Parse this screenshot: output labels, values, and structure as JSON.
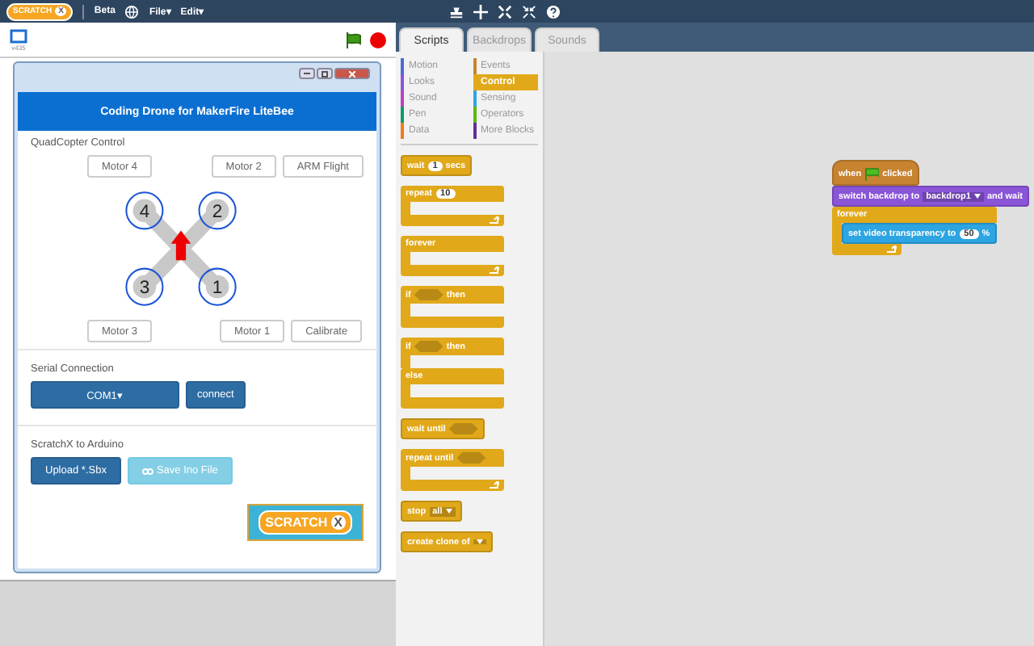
{
  "menu_bar": {
    "logo": {
      "text": "SCRATCH",
      "badge": "X"
    },
    "items": [
      {
        "kind": "label",
        "text": "Beta"
      },
      {
        "kind": "globe"
      },
      {
        "kind": "menu",
        "text": "File▾"
      },
      {
        "kind": "menu",
        "text": "Edit▾"
      }
    ]
  },
  "stage": {
    "version": "v435"
  },
  "dialog": {
    "title": "Coding Drone for MakerFire LiteBee",
    "quadcopter": {
      "heading": "QuadCopter Control",
      "top_buttons": [
        "Motor 4",
        "Motor 2",
        "ARM Flight"
      ],
      "bottom_buttons": [
        "Motor 3",
        "Motor 1",
        "Calibrate"
      ],
      "motors": [
        "4",
        "2",
        "3",
        "1"
      ]
    },
    "serial": {
      "heading": "Serial Connection",
      "port": "COM1▾",
      "button": "connect"
    },
    "arduino": {
      "heading": "ScratchX to Arduino",
      "buttons": [
        {
          "text": "Upload *.Sbx",
          "disabled": false,
          "link_icon": false
        },
        {
          "text": "Save Ino File",
          "disabled": true,
          "link_icon": true
        }
      ]
    },
    "logo": {
      "text": "SCRATCH",
      "badge": "X"
    }
  },
  "tabs": [
    {
      "label": "Scripts",
      "selected": true
    },
    {
      "label": "Backdrops",
      "selected": false
    },
    {
      "label": "Sounds",
      "selected": false
    }
  ],
  "categories": [
    {
      "label": "Motion",
      "color": "#4a6cd4",
      "selected": false
    },
    {
      "label": "Events",
      "color": "#c88330",
      "selected": false
    },
    {
      "label": "Looks",
      "color": "#8a55d7",
      "selected": false
    },
    {
      "label": "Control",
      "color": "#e1a91a",
      "selected": true
    },
    {
      "label": "Sound",
      "color": "#bb42c3",
      "selected": false
    },
    {
      "label": "Sensing",
      "color": "#2ca5e2",
      "selected": false
    },
    {
      "label": "Pen",
      "color": "#0e9a6c",
      "selected": false
    },
    {
      "label": "Operators",
      "color": "#5cb712",
      "selected": false
    },
    {
      "label": "Data",
      "color": "#ee7d16",
      "selected": false
    },
    {
      "label": "More Blocks",
      "color": "#632d99",
      "selected": false
    }
  ],
  "palette_blocks": [
    {
      "kind": "stack",
      "parts": [
        {
          "kind": "label",
          "text": "wait"
        },
        {
          "kind": "number",
          "text": "1"
        },
        {
          "kind": "label",
          "text": "secs"
        }
      ]
    },
    {
      "kind": "c",
      "loop": true,
      "parts": [
        {
          "kind": "label",
          "text": "repeat"
        },
        {
          "kind": "number",
          "text": "10"
        }
      ]
    },
    {
      "kind": "c",
      "loop": true,
      "parts": [
        {
          "kind": "label",
          "text": "forever"
        }
      ]
    },
    {
      "kind": "c",
      "loop": false,
      "parts": [
        {
          "kind": "label",
          "text": "if"
        },
        {
          "kind": "boolean"
        },
        {
          "kind": "label",
          "text": "then"
        }
      ]
    },
    {
      "kind": "if_else",
      "else_label": "else",
      "parts": [
        {
          "kind": "label",
          "text": "if"
        },
        {
          "kind": "boolean"
        },
        {
          "kind": "label",
          "text": "then"
        }
      ]
    },
    {
      "kind": "stack",
      "parts": [
        {
          "kind": "label",
          "text": "wait until"
        },
        {
          "kind": "boolean"
        }
      ]
    },
    {
      "kind": "c",
      "loop": true,
      "parts": [
        {
          "kind": "label",
          "text": "repeat until"
        },
        {
          "kind": "boolean"
        }
      ]
    },
    {
      "kind": "stack",
      "parts": [
        {
          "kind": "label",
          "text": "stop"
        },
        {
          "kind": "dropdown",
          "text": "all"
        }
      ]
    },
    {
      "kind": "stack",
      "parts": [
        {
          "kind": "label",
          "text": "create clone of"
        },
        {
          "kind": "dropdown"
        }
      ]
    }
  ],
  "script": {
    "hat": [
      {
        "kind": "label",
        "text": "when"
      },
      {
        "kind": "flag"
      },
      {
        "kind": "label",
        "text": "clicked"
      }
    ],
    "switch": [
      {
        "kind": "label",
        "text": "switch backdrop to"
      },
      {
        "kind": "dropdown",
        "text": "backdrop1"
      },
      {
        "kind": "label",
        "text": "and wait"
      }
    ],
    "forever": "forever",
    "inner": [
      {
        "kind": "label",
        "text": "set video transparency to"
      },
      {
        "kind": "number",
        "text": "50"
      },
      {
        "kind": "label",
        "text": "%"
      }
    ]
  }
}
